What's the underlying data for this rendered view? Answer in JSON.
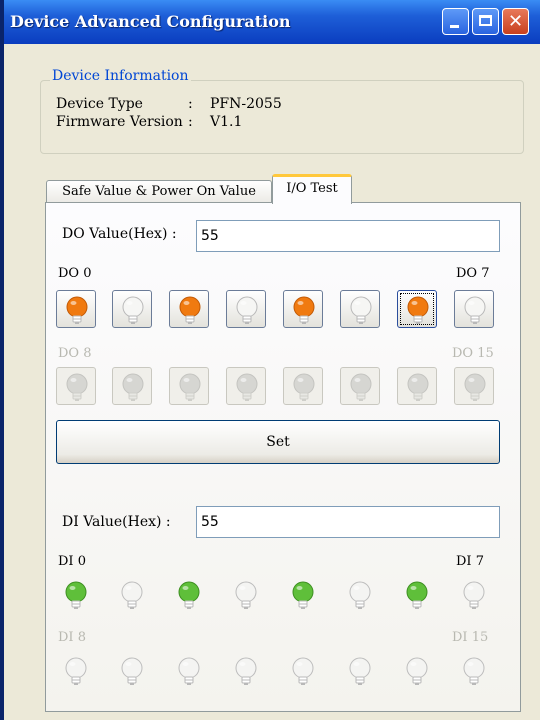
{
  "window": {
    "title": "Device Advanced Configuration",
    "close_glyph": "✕"
  },
  "device_info": {
    "legend": "Device Information",
    "rows": [
      {
        "label": "Device Type",
        "sep": ":",
        "value": "PFN-2055"
      },
      {
        "label": "Firmware Version",
        "sep": ":",
        "value": "V1.1"
      }
    ]
  },
  "tabs": [
    {
      "label": "Safe Value & Power On Value",
      "selected": false
    },
    {
      "label": "I/O Test",
      "selected": true
    }
  ],
  "do_section": {
    "value_label": "DO Value(Hex) :",
    "value": "55",
    "label_start": "DO 0",
    "label_end": "DO 7",
    "label_start2": "DO 8",
    "label_end2": "DO 15",
    "row1_states": [
      true,
      false,
      true,
      false,
      true,
      false,
      true,
      false
    ],
    "row1_focused_index": 6,
    "row2_enabled": false,
    "set_label": "Set"
  },
  "di_section": {
    "value_label": "DI Value(Hex) :",
    "value": "55",
    "label_start": "DI 0",
    "label_end": "DI 7",
    "label_start2": "DI 8",
    "label_end2": "DI 15",
    "row1_states": [
      true,
      false,
      true,
      false,
      true,
      false,
      true,
      false
    ],
    "row2_enabled": false
  },
  "colors": {
    "titlebar": "#0a3dbf",
    "do_on": "#f07a10",
    "di_on": "#5fbf3a",
    "tab_highlight": "#ffc83c",
    "legend_text": "#0046d5"
  },
  "icons": {
    "do_channel": "light-bulb-icon",
    "di_channel": "light-bulb-icon"
  }
}
